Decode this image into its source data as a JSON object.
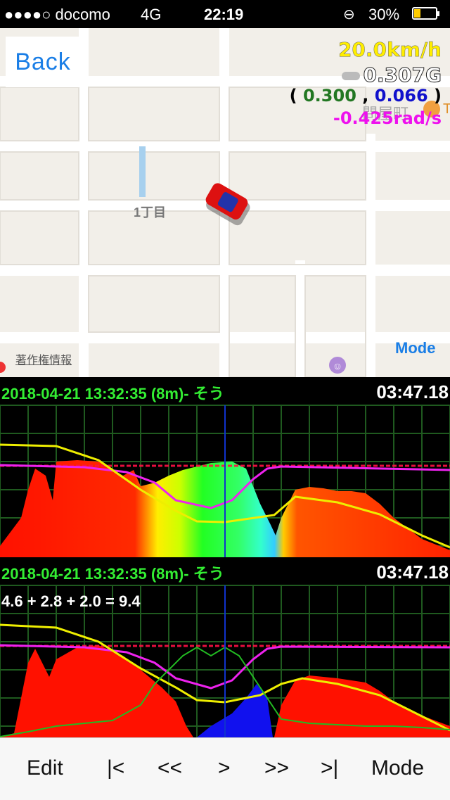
{
  "status": {
    "carrier": "●●●●○ docomo",
    "network": "4G",
    "time": "22:19",
    "battery": "30%",
    "battery_level": 0.3
  },
  "map": {
    "back_label": "Back",
    "district_label": "1丁目",
    "place_label": "問屋町",
    "place_label_partial": "T",
    "copyright_label": "著作権情報",
    "mode_label": "Mode",
    "speed": "20.0km/h",
    "gforce": "0.307G",
    "vector_open": "(",
    "vector_x": "0.300",
    "vector_sep": ",",
    "vector_y": "0.066",
    "vector_close": ")",
    "yaw": "-0.425rad/s",
    "colors": {
      "speed": "#ffee00",
      "vec_x": "#227722",
      "vec_y": "#1111cc",
      "yaw": "#ee11ee",
      "car": "#dd1111"
    }
  },
  "panel1": {
    "title": "2018-04-21 13:32:35 (8m)- そう",
    "time": "03:47.18"
  },
  "panel2": {
    "title": "2018-04-21 13:32:35 (8m)- そう",
    "time": "03:47.18",
    "formula": "4.6 + 2.8 + 2.0 = 9.4"
  },
  "toolbar": {
    "edit": "Edit",
    "first": "|<",
    "rewind": "<<",
    "play": ">",
    "forward": ">>",
    "last": ">|",
    "mode": "Mode"
  }
}
